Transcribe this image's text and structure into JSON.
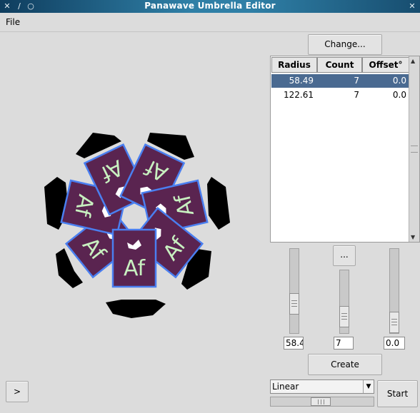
{
  "window": {
    "title": "Panawave Umbrella Editor"
  },
  "titlebar_icons": [
    "menu-x-icon",
    "slash-icon",
    "circle-icon",
    "close-x-icon"
  ],
  "menu": {
    "file": "File"
  },
  "change_button": "Change...",
  "table": {
    "columns": [
      "Radius",
      "Count",
      "Offset°"
    ],
    "rows": [
      {
        "radius": "58.49",
        "count": "7",
        "offset": "0.0",
        "selected": true
      },
      {
        "radius": "122.61",
        "count": "7",
        "offset": "0.0",
        "selected": false
      }
    ]
  },
  "ellipsis_button": "...",
  "sliders": {
    "radius": {
      "value": "58.4"
    },
    "count": {
      "value": "7"
    },
    "offset": {
      "value": "0.0"
    }
  },
  "create_button": "Create",
  "expand_button": ">",
  "interpolation": {
    "selected": "Linear"
  },
  "start_button": "Start",
  "colors": {
    "titlebar": "#2f7fa6",
    "tile_fill": "#5a2450",
    "tile_border": "#4a7ff0",
    "tile_text": "#c8f0c0",
    "selection": "#4a6a91"
  },
  "preview": {
    "tile_text": "Af",
    "tile_count": 7
  }
}
